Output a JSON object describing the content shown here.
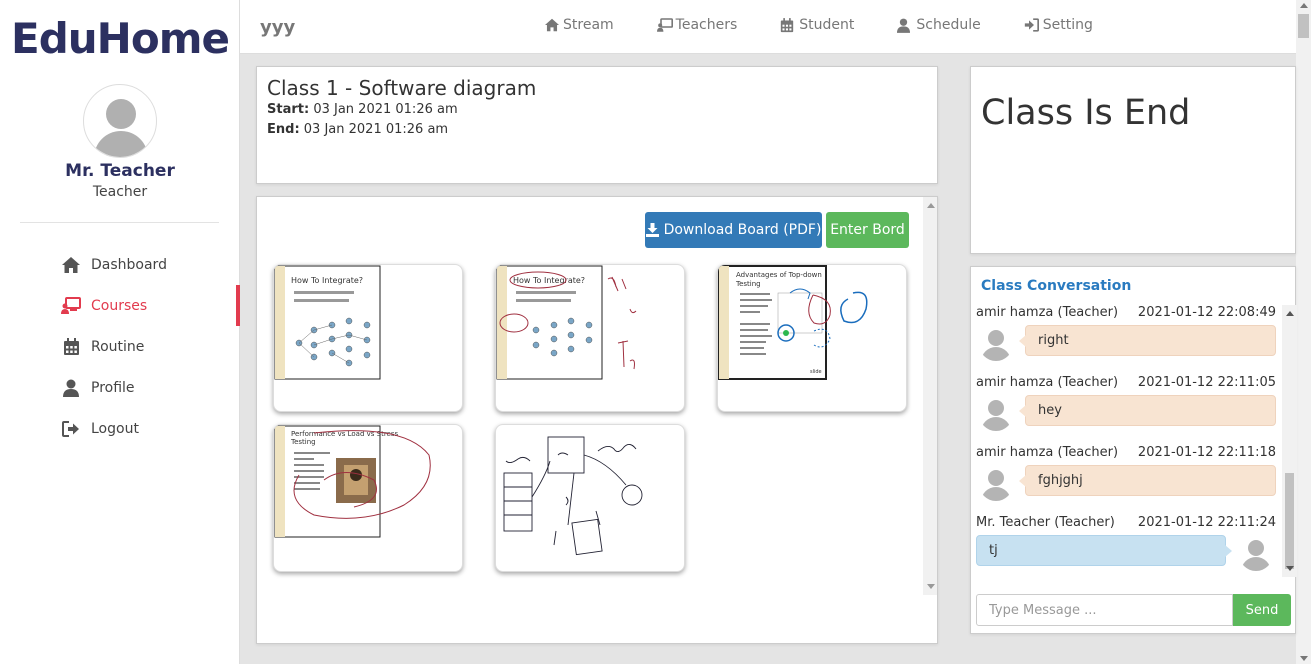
{
  "sidebar": {
    "logo": "EduHome",
    "user_name": "Mr. Teacher",
    "user_role": "Teacher",
    "items": [
      {
        "label": "Dashboard",
        "icon": "home-icon"
      },
      {
        "label": "Courses",
        "icon": "courses-icon",
        "active": true
      },
      {
        "label": "Routine",
        "icon": "calendar-icon"
      },
      {
        "label": "Profile",
        "icon": "user-icon"
      },
      {
        "label": "Logout",
        "icon": "logout-icon"
      }
    ],
    "active_color": "#e23b4e"
  },
  "topbar": {
    "title": "yyy",
    "nav": [
      {
        "label": "Stream",
        "icon": "home-icon"
      },
      {
        "label": "Teachers",
        "icon": "teacher-icon"
      },
      {
        "label": "Student",
        "icon": "calendar-icon"
      },
      {
        "label": "Schedule",
        "icon": "user-icon"
      },
      {
        "label": "Setting",
        "icon": "sign-in-icon"
      }
    ]
  },
  "class_info": {
    "title": "Class 1 - Software diagram",
    "start_label": "Start:",
    "start_value": "03 Jan 2021 01:26 am",
    "end_label": "End:",
    "end_value": "03 Jan 2021 01:26 am"
  },
  "board": {
    "download_label": "Download Board (PDF)",
    "enter_label": "Enter Bord",
    "download_color": "#337ab7",
    "enter_color": "#5cb85c",
    "slides": [
      {
        "title": "How To Integrate?",
        "kind": "slide"
      },
      {
        "title": "How To Integrate?",
        "kind": "slide-annotated"
      },
      {
        "title": "Advantages of Top-down Testing",
        "kind": "slide-annotated"
      },
      {
        "title": "Performance vs Load vs Stress Testing",
        "kind": "slide-annotated"
      },
      {
        "title": "",
        "kind": "sketch"
      }
    ]
  },
  "status": {
    "text": "Class Is End"
  },
  "chat": {
    "header": "Class Conversation",
    "messages": [
      {
        "name": "amir hamza (Teacher)",
        "time": "2021-01-12 22:08:49",
        "text": "right",
        "self": false
      },
      {
        "name": "amir hamza (Teacher)",
        "time": "2021-01-12 22:11:05",
        "text": "hey",
        "self": false
      },
      {
        "name": "amir hamza (Teacher)",
        "time": "2021-01-12 22:11:18",
        "text": "fghjghj",
        "self": false
      },
      {
        "name": "Mr. Teacher (Teacher)",
        "time": "2021-01-12 22:11:24",
        "text": "tj",
        "self": true
      }
    ],
    "input_placeholder": "Type Message ...",
    "send_label": "Send"
  }
}
